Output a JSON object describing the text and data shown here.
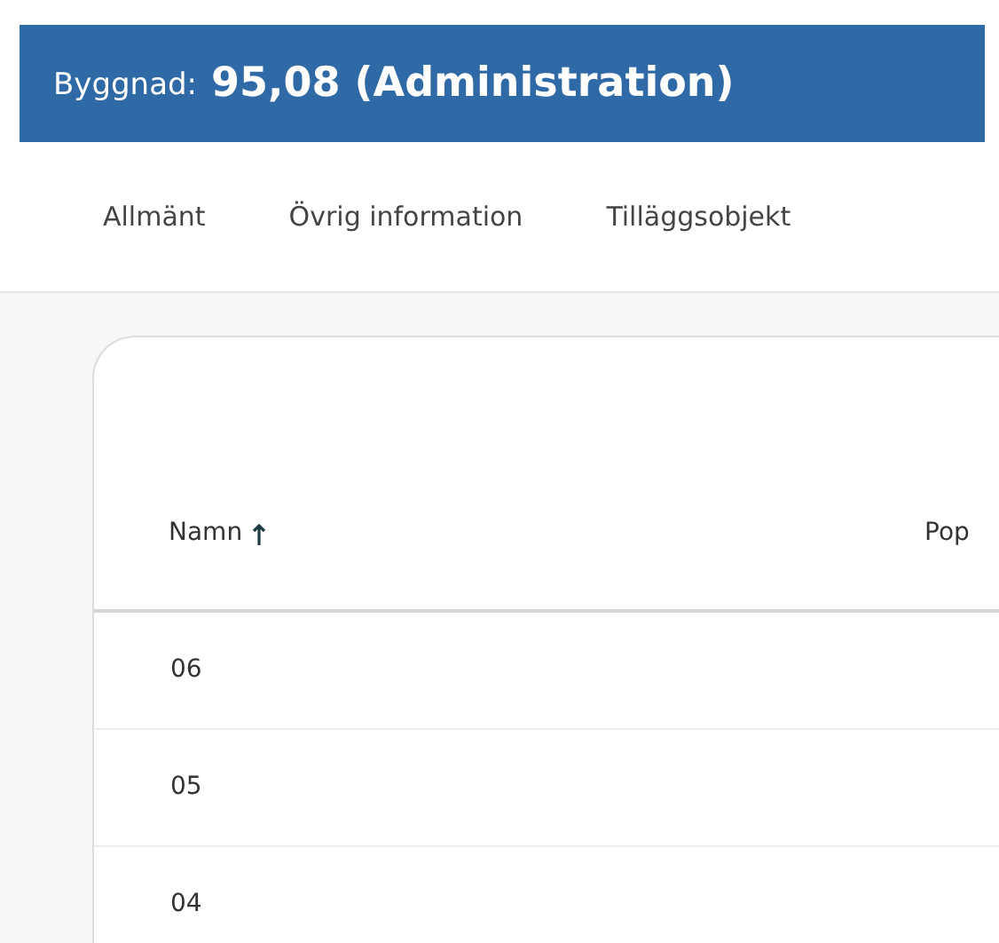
{
  "header": {
    "label": "Byggnad:",
    "title": "95,08 (Administration)"
  },
  "tabs": [
    {
      "label": "Allmänt",
      "selected": false
    },
    {
      "label": "Övrig information",
      "selected": false
    },
    {
      "label": "Tilläggsobjekt",
      "selected": false
    }
  ],
  "table": {
    "columns": [
      {
        "label": "Namn",
        "sorted": true
      },
      {
        "label": "Pop",
        "sorted": false
      }
    ],
    "rows": [
      [
        "06",
        ""
      ],
      [
        "05",
        ""
      ],
      [
        "04",
        ""
      ]
    ]
  }
}
